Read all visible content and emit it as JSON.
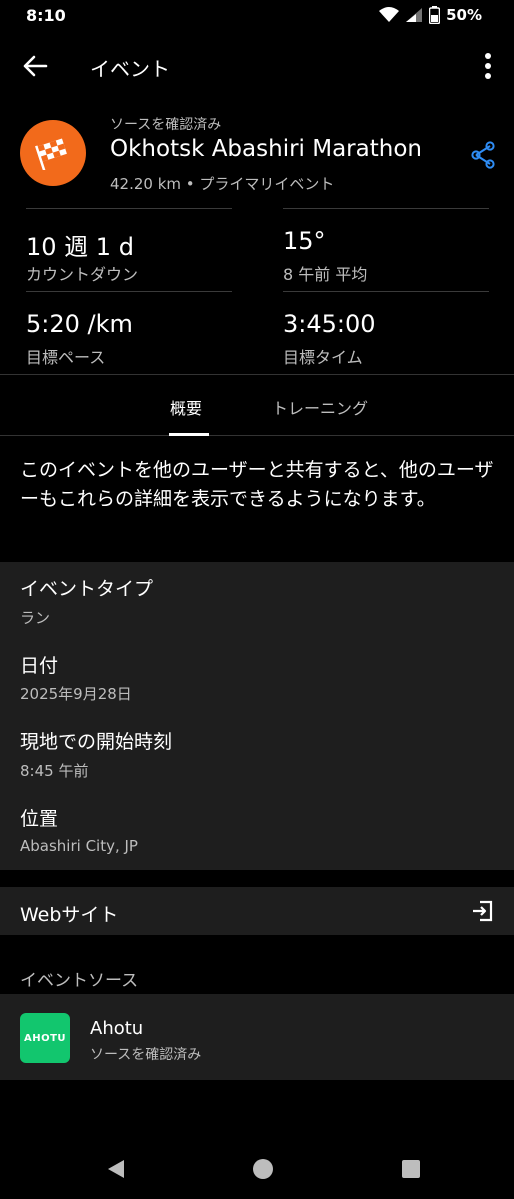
{
  "status_bar": {
    "time": "8:10",
    "battery": "50%",
    "icons": [
      "wifi-icon",
      "signal-icon",
      "battery-icon"
    ]
  },
  "app_bar": {
    "title": "イベント",
    "back_icon": "arrow-back-icon",
    "more_icon": "more-vertical-icon"
  },
  "event": {
    "verified_label": "ソースを確認済み",
    "name": "Okhotsk Abashiri Marathon",
    "subtitle": "42.20 km • プライマリイベント",
    "logo_icon": "checkered-flag-icon",
    "logo_color": "#f26a1b",
    "share_icon": "share-icon",
    "accent_color": "#2f8df5"
  },
  "stats": [
    {
      "value": "10 週 1 d",
      "label": "カウントダウン"
    },
    {
      "value": "15°",
      "label": "8 午前 平均"
    },
    {
      "value": "5:20 /km",
      "label": "目標ペース"
    },
    {
      "value": "3:45:00",
      "label": "目標タイム"
    }
  ],
  "tabs": [
    {
      "label": "概要",
      "active": true
    },
    {
      "label": "トレーニング",
      "active": false
    }
  ],
  "share_notice": "このイベントを他のユーザーと共有すると、他のユーザーもこれらの詳細を表示できるようになります。",
  "details": [
    {
      "label": "イベントタイプ",
      "value": "ラン"
    },
    {
      "label": "日付",
      "value": "2025年9月28日"
    },
    {
      "label": "現地での開始時刻",
      "value": "8:45 午前"
    },
    {
      "label": "位置",
      "value": "Abashiri City, JP"
    }
  ],
  "website": {
    "label": "Webサイト",
    "icon": "open-link-icon"
  },
  "event_source": {
    "heading": "イベントソース",
    "logo_text": "AHOTU",
    "logo_color": "#12c66e",
    "name": "Ahotu",
    "verified": "ソースを確認済み"
  },
  "nav": {
    "icons": [
      "back-triangle-icon",
      "home-circle-icon",
      "recents-square-icon"
    ]
  }
}
